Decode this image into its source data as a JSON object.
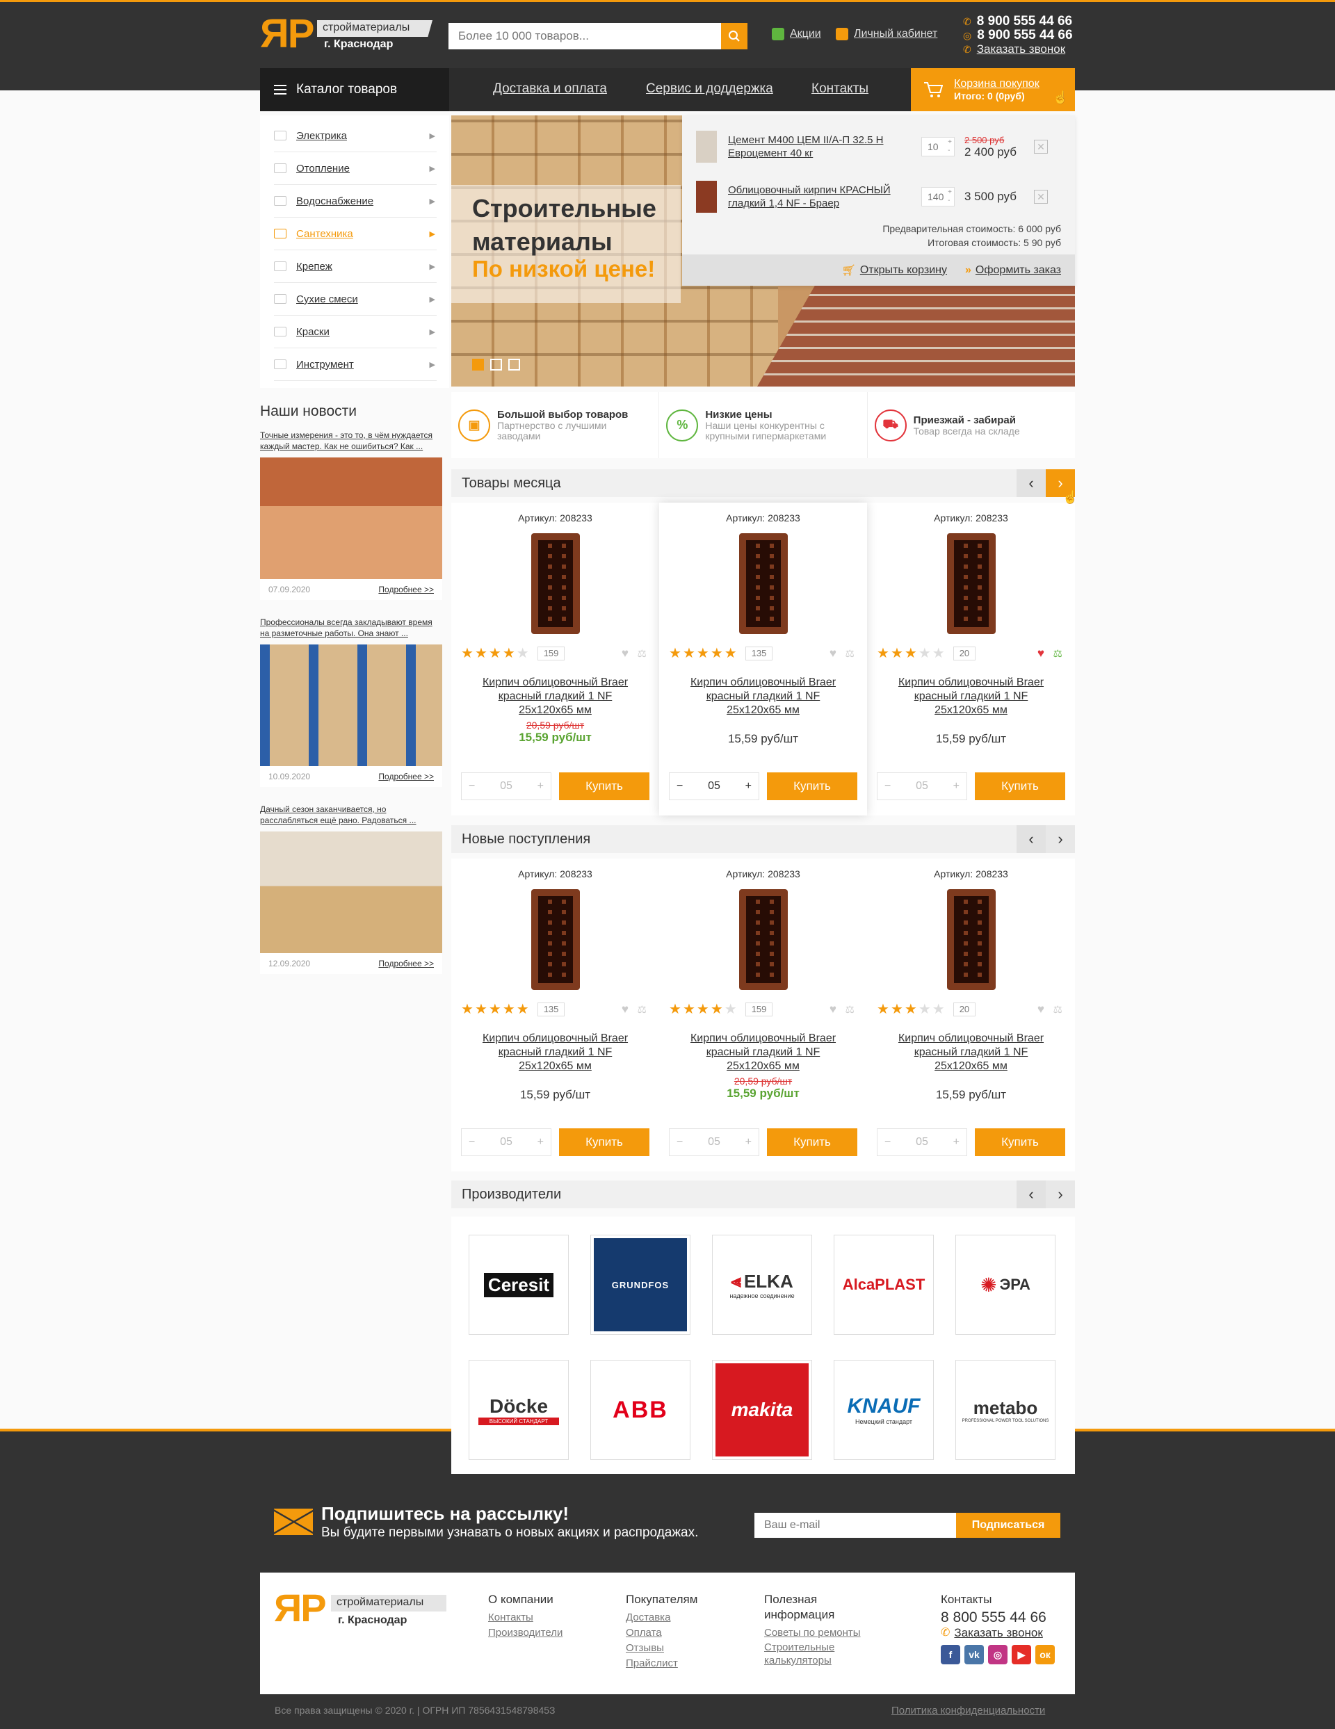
{
  "header": {
    "logo_big": "ЯР",
    "logo_tag": "стройматериалы",
    "logo_city": "г. Краснодар",
    "search_placeholder": "Более 10 000 товаров...",
    "promo_link": "Акции",
    "account_link": "Личный кабинет",
    "phone1": "8 900 555 44 66",
    "phone2": "8 900 555 44 66",
    "callback": "Заказать звонок",
    "accent": "#f49a0c"
  },
  "nav": {
    "catalog": "Каталог товаров",
    "links": [
      "Доставка и оплата",
      "Сервис и доддержка",
      "Контакты"
    ],
    "cart_title": "Корзина покупок",
    "cart_total": "Итого: 0 (0руб)"
  },
  "sidebar": {
    "items": [
      {
        "label": "Электрика",
        "icon": "plug-icon"
      },
      {
        "label": "Отопление",
        "icon": "radiator-icon"
      },
      {
        "label": "Водоснабжение",
        "icon": "faucet-icon"
      },
      {
        "label": "Сантехника",
        "icon": "bathtub-icon",
        "active": true
      },
      {
        "label": "Крепеж",
        "icon": "bolt-icon"
      },
      {
        "label": "Сухие смеси",
        "icon": "bag-icon"
      },
      {
        "label": "Краски",
        "icon": "paint-icon"
      },
      {
        "label": "Инструмент",
        "icon": "tools-icon"
      }
    ]
  },
  "hero": {
    "line1": "Строительные",
    "line2": "материалы",
    "line3": "По низкой цене!"
  },
  "minicart": {
    "items": [
      {
        "title": "Цемент М400 ЦЕМ II/А-П 32.5 Н Евроцемент 40 кг",
        "qty": "10",
        "old": "2 500 руб",
        "price": "2 400 руб"
      },
      {
        "title": "Облицовочный кирпич КРАСНЫЙ гладкий 1,4 NF - Браер",
        "qty": "140",
        "old": "",
        "price": "3 500 руб"
      }
    ],
    "pre_total": "Предварительная стоимость: 6 000 руб",
    "final_total": "Итоговая стоимость: 5 90 руб",
    "open_cart": "Открыть корзину",
    "checkout": "Оформить заказ"
  },
  "features": [
    {
      "title": "Большой выбор товаров",
      "sub": "Партнерство с лучшими заводами",
      "icon": "box-icon"
    },
    {
      "title": "Низкие цены",
      "sub": "Наши цены конкурентны с крупными гипермаркетами",
      "icon": "percent-icon"
    },
    {
      "title": "Приезжай - забирай",
      "sub": "Товар всегда на складе",
      "icon": "truck-icon"
    }
  ],
  "news": {
    "title": "Наши новости",
    "more": "Подробнее >>",
    "items": [
      {
        "text": "Точные измерения - это то, в чём нуждается каждый мастер. Как не ошибиться? Как ...",
        "date": "07.09.2020"
      },
      {
        "text": "Профессионалы всегда закладывают время на разметочные работы. Она знают ...",
        "date": "10.09.2020"
      },
      {
        "text": "Дачный сезон заканчивается, но расслабляться ещё рано. Радоваться ...",
        "date": "12.09.2020"
      }
    ]
  },
  "month": {
    "title": "Товары месяца",
    "products": [
      {
        "art_label": "Артикул:",
        "art": "208233",
        "stars": 4,
        "reviews": "159",
        "name": "Кирпич облицовочный Braer красный гладкий 1 NF 25х120х65 мм",
        "old": "20,59 руб/шт",
        "price": "15,59 руб/шт",
        "qty": "05",
        "buy": "Купить"
      },
      {
        "art_label": "Артикул:",
        "art": "208233",
        "stars": 5,
        "reviews": "135",
        "name": "Кирпич облицовочный Braer красный гладкий 1 NF 25х120х65 мм",
        "old": "",
        "price": "15,59 руб/шт",
        "qty": "05",
        "buy": "Купить"
      },
      {
        "art_label": "Артикул:",
        "art": "208233",
        "stars": 3,
        "reviews": "20",
        "name": "Кирпич облицовочный Braer красный гладкий 1 NF 25х120х65 мм",
        "old": "",
        "price": "15,59 руб/шт",
        "qty": "05",
        "buy": "Купить"
      }
    ]
  },
  "newarr": {
    "title": "Новые поступления",
    "products": [
      {
        "art_label": "Артикул:",
        "art": "208233",
        "stars": 5,
        "reviews": "135",
        "name": "Кирпич облицовочный Braer красный гладкий 1 NF 25х120х65 мм",
        "old": "",
        "price": "15,59 руб/шт",
        "qty": "05",
        "buy": "Купить"
      },
      {
        "art_label": "Артикул:",
        "art": "208233",
        "stars": 4,
        "reviews": "159",
        "name": "Кирпич облицовочный Braer красный гладкий 1 NF 25х120х65 мм",
        "old": "20,59 руб/шт",
        "price": "15,59 руб/шт",
        "qty": "05",
        "buy": "Купить"
      },
      {
        "art_label": "Артикул:",
        "art": "208233",
        "stars": 3,
        "reviews": "20",
        "name": "Кирпич облицовочный Braer красный гладкий 1 NF 25х120х65 мм",
        "old": "",
        "price": "15,59 руб/шт",
        "qty": "05",
        "buy": "Купить"
      }
    ]
  },
  "brands": {
    "title": "Производители",
    "items": [
      "Ceresit",
      "GRUNDFOS",
      "ELKA",
      "AlcaPLAST",
      "ЭРА",
      "Döcke",
      "ABB",
      "makita",
      "KNAUF",
      "metabo"
    ],
    "elka_sub": "надежное соединение",
    "docke_sub": "ВЫСОКИЙ СТАНДАРТ",
    "knauf_sub": "Немецкий стандарт",
    "metabo_sub": "PROFESSIONAL POWER TOOL SOLUTIONS"
  },
  "subscribe": {
    "title": "Подпишитесь на рассылку!",
    "sub": "Вы будите первыми узнавать о новых акциях и распродажах.",
    "placeholder": "Ваш e-mail",
    "button": "Подписаться"
  },
  "footer": {
    "col1_title": "О компании",
    "col1": [
      "Контакты",
      "Производители"
    ],
    "col2_title": "Покупателям",
    "col2": [
      "Доставка",
      "Оплата",
      "Отзывы",
      "Прайслист"
    ],
    "col3_title": "Полезная информация",
    "col3": [
      "Советы по ремонты",
      "Строительные калькуляторы"
    ],
    "col4_title": "Контакты",
    "phone": "8 800 555 44 66",
    "callback": "Заказать звонок",
    "copyright": "Все права защищены © 2020 г. | ОГРН ИП 785643154879845З",
    "policy": "Политика конфиденциальности"
  }
}
